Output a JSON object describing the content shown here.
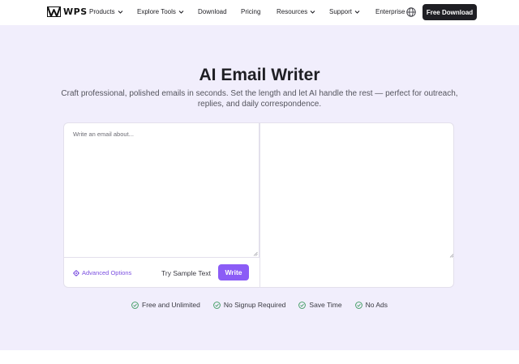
{
  "header": {
    "logo_text": "WPS",
    "nav": [
      {
        "label": "Products",
        "has_dropdown": true
      },
      {
        "label": "Explore Tools",
        "has_dropdown": true
      },
      {
        "label": "Download",
        "has_dropdown": false
      },
      {
        "label": "Pricing",
        "has_dropdown": false
      },
      {
        "label": "Resources",
        "has_dropdown": true
      },
      {
        "label": "Support",
        "has_dropdown": true
      },
      {
        "label": "Enterprise",
        "has_dropdown": false
      }
    ],
    "globe_icon": "globe-icon",
    "cta_label": "Free Download"
  },
  "hero": {
    "title": "AI Email Writer",
    "subtitle": "Craft professional, polished emails in seconds. Set the length and let AI handle the rest — perfect for outreach, replies, and daily correspondence."
  },
  "editor": {
    "input_placeholder": "Write an email about...",
    "input_value": "",
    "advanced_label": "Advanced Options",
    "sample_label": "Try Sample Text",
    "write_label": "Write"
  },
  "features": [
    {
      "label": "Free and Unlimited"
    },
    {
      "label": "No Signup Required"
    },
    {
      "label": "Save Time"
    },
    {
      "label": "No Ads"
    }
  ],
  "colors": {
    "accent": "#8b5cf6",
    "hero_bg": "#f1eefc",
    "dark_button": "#1f1f24",
    "check_green": "#3c9a5f"
  }
}
